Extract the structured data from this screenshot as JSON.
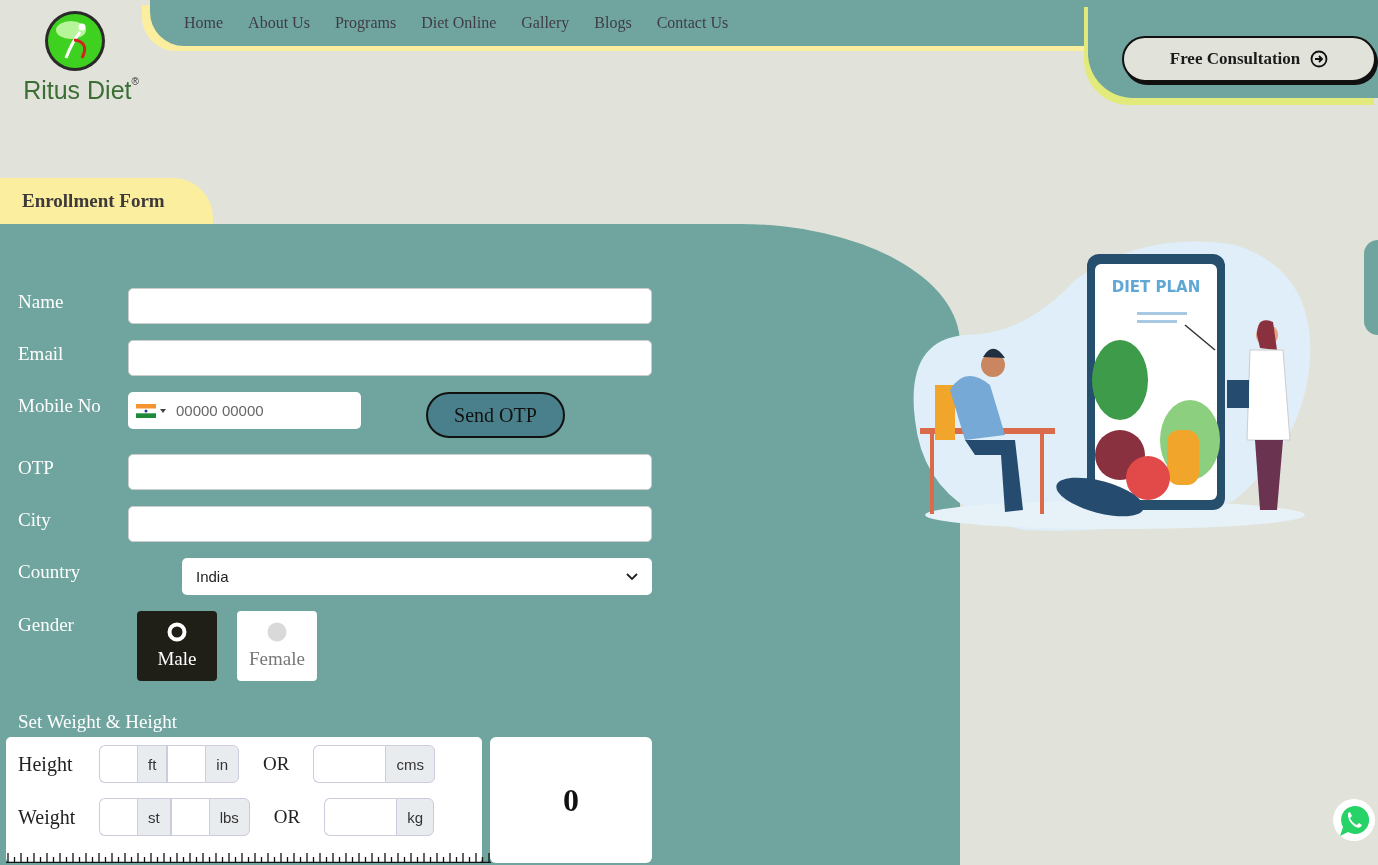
{
  "logo": {
    "text": "Ritus Diet",
    "mark": "®"
  },
  "nav": [
    {
      "label": "Home"
    },
    {
      "label": "About Us"
    },
    {
      "label": "Programs"
    },
    {
      "label": "Diet Online"
    },
    {
      "label": "Gallery"
    },
    {
      "label": "Blogs"
    },
    {
      "label": "Contact Us"
    }
  ],
  "cta": {
    "label": "Free Consultation"
  },
  "form_tab": "Enrollment Form",
  "fields": [
    {
      "kind": "text",
      "label": "Name"
    },
    {
      "kind": "text",
      "label": "Email"
    },
    {
      "kind": "phone",
      "label": "Mobile No",
      "placeholder": "00000 00000",
      "button": "Send OTP"
    },
    {
      "kind": "text",
      "label": "OTP"
    },
    {
      "kind": "text",
      "label": "City"
    },
    {
      "kind": "select",
      "label": "Country",
      "value": "India"
    },
    {
      "kind": "gender",
      "label": "Gender",
      "options": [
        {
          "label": "Male",
          "selected": true
        },
        {
          "label": "Female",
          "selected": false
        }
      ]
    }
  ],
  "measure": {
    "title": "Set Weight & Height",
    "rows": [
      {
        "label": "Height",
        "units": [
          "ft",
          "in"
        ],
        "or": "OR",
        "alt_unit": "cms"
      },
      {
        "label": "Weight",
        "units": [
          "st",
          "lbs"
        ],
        "or": "OR",
        "alt_unit": "kg"
      }
    ],
    "result": "0"
  },
  "illustration": {
    "caption": "DIET PLAN"
  }
}
